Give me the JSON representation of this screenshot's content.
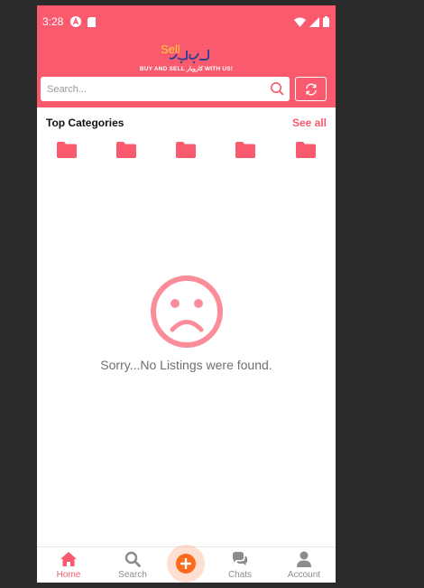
{
  "status_bar": {
    "time": "3:28"
  },
  "logo": {
    "sell_text": "Sell",
    "urdu_text": "کاروبار",
    "tagline": "BUY AND SELL کاروبار WITH US!"
  },
  "search": {
    "placeholder": "Search..."
  },
  "categories": {
    "title": "Top Categories",
    "see_all_label": "See all",
    "items": [
      {
        "icon": "folder-icon"
      },
      {
        "icon": "folder-icon"
      },
      {
        "icon": "folder-icon"
      },
      {
        "icon": "folder-icon"
      },
      {
        "icon": "folder-icon"
      }
    ]
  },
  "empty_state": {
    "icon": "sad-face-icon",
    "message": "Sorry...No Listings were found."
  },
  "bottom_nav": {
    "items": [
      {
        "label": "Home",
        "icon": "home-icon",
        "active": true
      },
      {
        "label": "Search",
        "icon": "search-icon",
        "active": false
      },
      {
        "label": "Chats",
        "icon": "chat-icon",
        "active": false
      },
      {
        "label": "Account",
        "icon": "account-icon",
        "active": false
      }
    ],
    "add_icon": "plus-icon"
  },
  "colors": {
    "brand": "#fa5a6e",
    "accent_orange": "#fb6a1d",
    "logo_yellow": "#ffcf3a",
    "empty_icon": "#fb8d9b",
    "inactive_nav": "#8c8c8c"
  }
}
